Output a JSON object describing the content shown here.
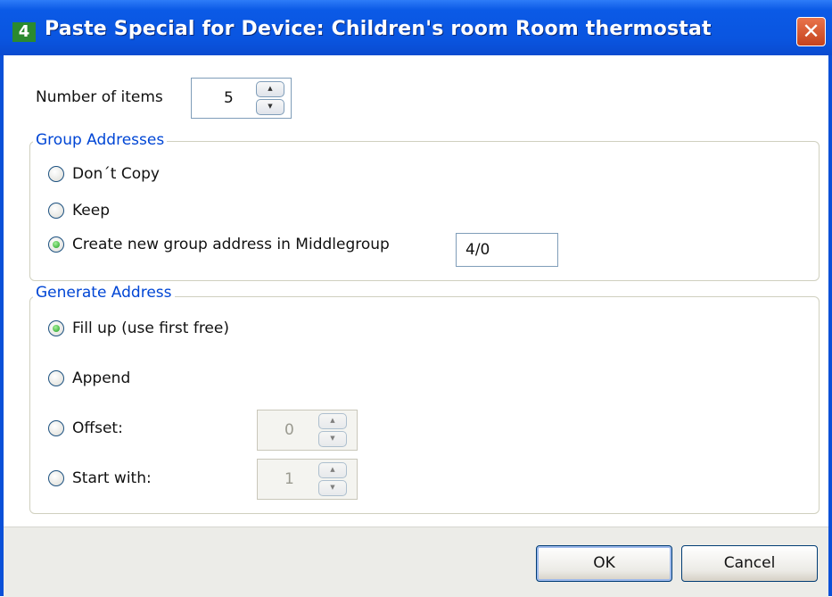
{
  "window": {
    "title": "Paste Special for Device: Children's room Room thermostat",
    "app_icon": "4",
    "close_glyph": "✕"
  },
  "items": {
    "label": "Number of items",
    "value": "5"
  },
  "group_addresses": {
    "legend": "Group Addresses",
    "options": [
      "Don´t Copy",
      "Keep",
      "Create new group address in Middlegroup"
    ],
    "selected": 2,
    "middlegroup_value": "4/0"
  },
  "generate_address": {
    "legend": "Generate Address",
    "options": [
      "Fill up (use first free)",
      "Append",
      "Offset:",
      "Start with:"
    ],
    "selected": 0,
    "offset_value": "0",
    "start_value": "1"
  },
  "buttons": {
    "ok": "OK",
    "cancel": "Cancel"
  },
  "spin_glyphs": {
    "up": "▲",
    "down": "▼"
  },
  "colors": {
    "titlebar": "#0a55e0",
    "legend": "#0046d5",
    "selected_radio": "#1f9e20"
  }
}
